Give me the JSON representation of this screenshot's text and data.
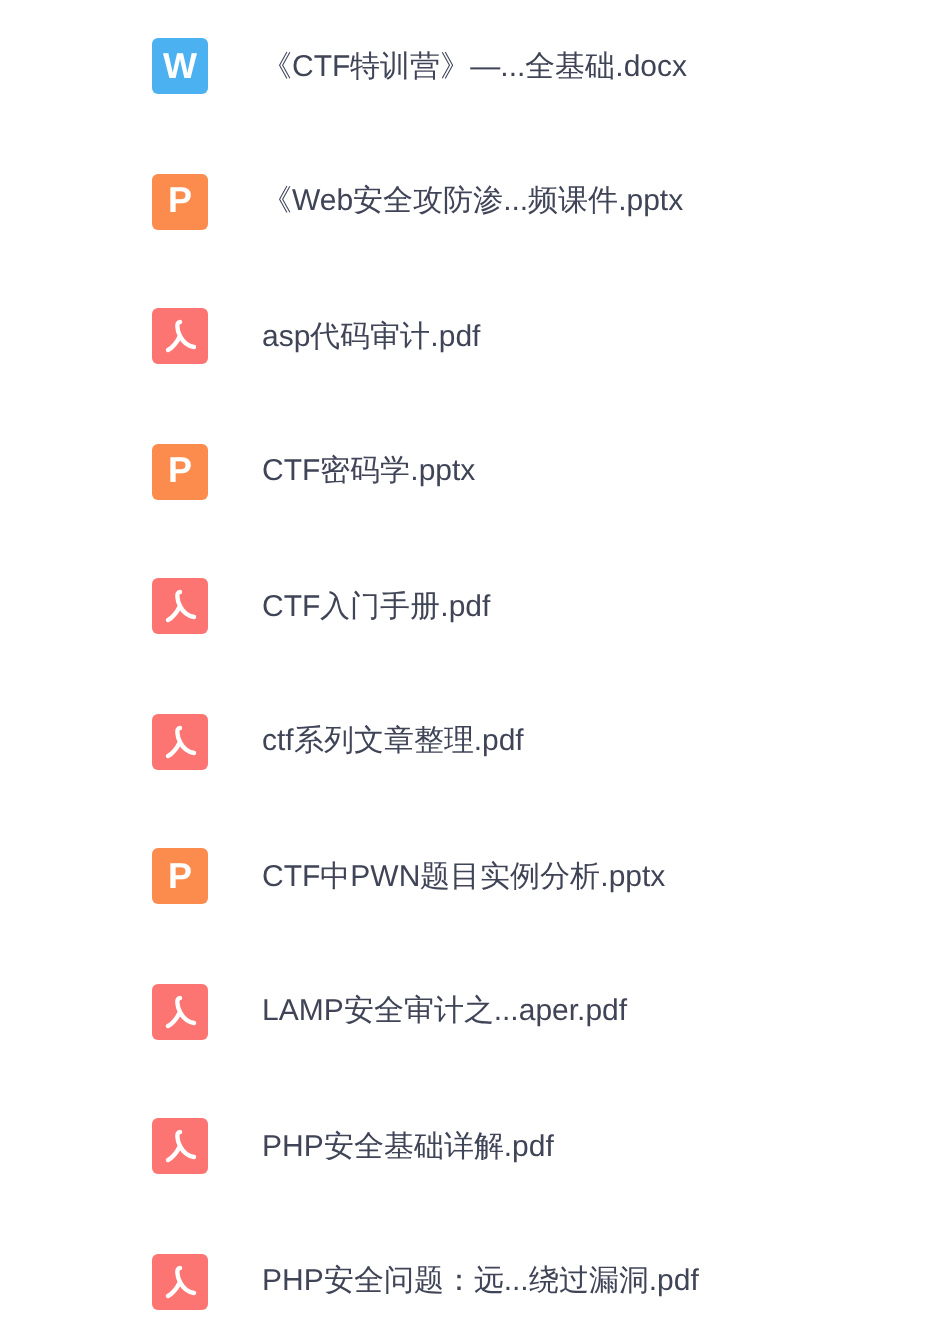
{
  "files": [
    {
      "kind": "docx",
      "icon_text": "W",
      "name": "《CTF特训营》—...全基础.docx"
    },
    {
      "kind": "pptx",
      "icon_text": "P",
      "name": "《Web安全攻防渗...频课件.pptx"
    },
    {
      "kind": "pdf",
      "name": "asp代码审计.pdf"
    },
    {
      "kind": "pptx",
      "icon_text": "P",
      "name": "CTF密码学.pptx"
    },
    {
      "kind": "pdf",
      "name": "CTF入门手册.pdf"
    },
    {
      "kind": "pdf",
      "name": "ctf系列文章整理.pdf"
    },
    {
      "kind": "pptx",
      "icon_text": "P",
      "name": "CTF中PWN题目实例分析.pptx"
    },
    {
      "kind": "pdf",
      "name": "LAMP安全审计之...aper.pdf"
    },
    {
      "kind": "pdf",
      "name": "PHP安全基础详解.pdf"
    },
    {
      "kind": "pdf",
      "name": "PHP安全问题：远...绕过漏洞.pdf"
    }
  ]
}
